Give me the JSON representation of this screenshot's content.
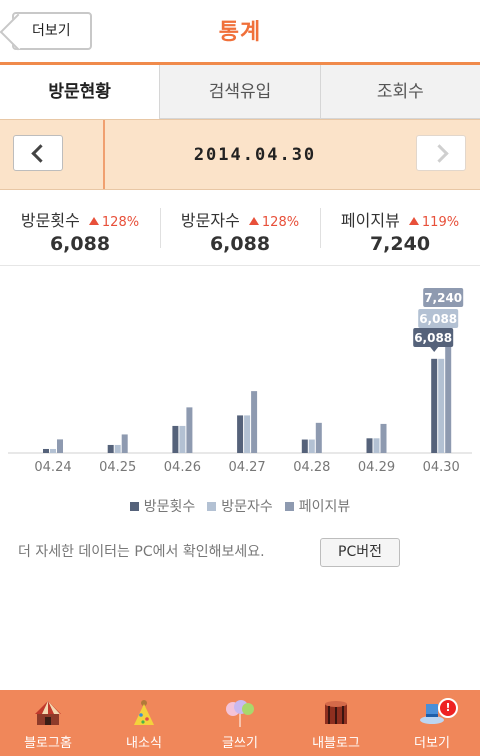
{
  "header": {
    "back_label": "더보기",
    "title": "통계"
  },
  "tabs": [
    {
      "label": "방문현황",
      "active": true
    },
    {
      "label": "검색유입",
      "active": false
    },
    {
      "label": "조회수",
      "active": false
    }
  ],
  "date_bar": {
    "date": "2014.04.30",
    "prev_icon": "chevron-left-icon",
    "next_icon": "chevron-right-icon"
  },
  "stats": [
    {
      "label": "방문횟수",
      "delta": "128%",
      "value": "6,088"
    },
    {
      "label": "방문자수",
      "delta": "128%",
      "value": "6,088"
    },
    {
      "label": "페이지뷰",
      "delta": "119%",
      "value": "7,240"
    }
  ],
  "chart_data": {
    "type": "bar",
    "categories": [
      "04.24",
      "04.25",
      "04.26",
      "04.27",
      "04.28",
      "04.29",
      "04.30"
    ],
    "series": [
      {
        "name": "방문횟수",
        "color": "#55627a",
        "values": [
          260,
          520,
          1750,
          2430,
          870,
          950,
          6088
        ]
      },
      {
        "name": "방문자수",
        "color": "#b3c1d3",
        "values": [
          260,
          520,
          1750,
          2430,
          870,
          950,
          6088
        ]
      },
      {
        "name": "페이지뷰",
        "color": "#8e9ab0",
        "values": [
          880,
          1200,
          2950,
          4000,
          1950,
          1880,
          7240
        ]
      }
    ],
    "ylim": [
      0,
      7240
    ],
    "callouts": [
      {
        "series": 0,
        "index": 6,
        "label": "6,088"
      },
      {
        "series": 1,
        "index": 6,
        "label": "6,088"
      },
      {
        "series": 2,
        "index": 6,
        "label": "7,240"
      }
    ],
    "legend_position": "bottom"
  },
  "info": {
    "text": "더 자세한 데이터는 PC에서 확인해보세요.",
    "pc_button": "PC버전"
  },
  "bottom_nav": [
    {
      "label": "블로그홈",
      "icon": "circus-tent-icon"
    },
    {
      "label": "내소식",
      "icon": "party-hat-icon"
    },
    {
      "label": "글쓰기",
      "icon": "balloons-icon"
    },
    {
      "label": "내블로그",
      "icon": "drum-icon"
    },
    {
      "label": "더보기",
      "icon": "more-hat-icon",
      "badge": "!"
    }
  ]
}
